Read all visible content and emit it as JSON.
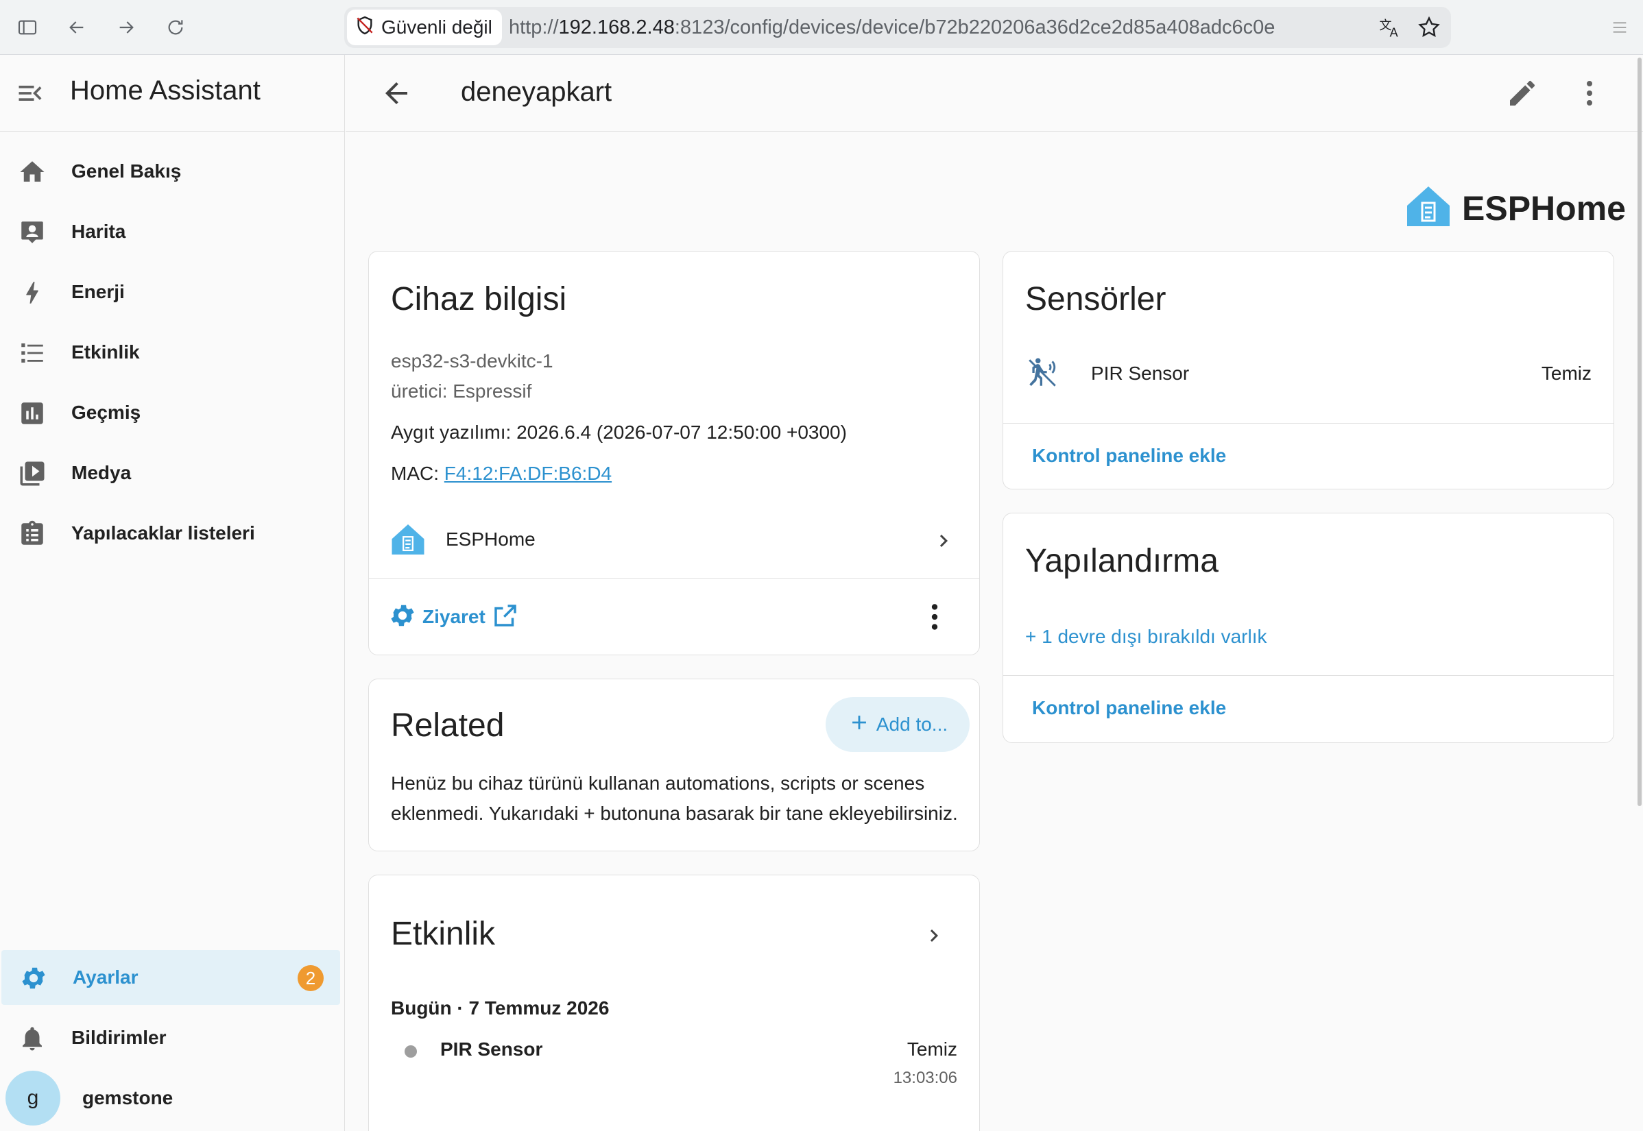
{
  "browser": {
    "security_label": "Güvenli değil",
    "url_scheme": "http://",
    "url_host": "192.168.2.48",
    "url_path": ":8123/config/devices/device/b72b220206a36d2ce2d85a408adc6c0e"
  },
  "sidebar": {
    "title": "Home Assistant",
    "items": [
      {
        "label": "Genel Bakış",
        "icon": "home-icon"
      },
      {
        "label": "Harita",
        "icon": "map-account-icon"
      },
      {
        "label": "Enerji",
        "icon": "lightning-bolt-icon"
      },
      {
        "label": "Etkinlik",
        "icon": "format-list-icon"
      },
      {
        "label": "Geçmiş",
        "icon": "chart-box-icon"
      },
      {
        "label": "Medya",
        "icon": "play-box-multiple-icon"
      },
      {
        "label": "Yapılacaklar listeleri",
        "icon": "clipboard-list-icon"
      }
    ],
    "settings_label": "Ayarlar",
    "settings_badge": "2",
    "notifications_label": "Bildirimler",
    "user_initial": "g",
    "user_name": "gemstone",
    "accent_color": "#2c91cf",
    "badge_color": "#ef9a30"
  },
  "header": {
    "title": "deneyapkart"
  },
  "brand": {
    "name": "ESPHome",
    "color": "#4fb3e8"
  },
  "device_info": {
    "title": "Cihaz bilgisi",
    "model": "esp32-s3-devkitc-1",
    "manufacturer": "üretici: Espressif",
    "firmware": "Aygıt yazılımı: 2026.6.4 (2026-07-07 12:50:00 +0300)",
    "mac_label": "MAC: ",
    "mac_value": "F4:12:FA:DF:B6:D4",
    "integration": "ESPHome",
    "visit_label": "Ziyaret"
  },
  "related": {
    "title": "Related",
    "add_label": "Add to...",
    "text_line1": "Henüz bu cihaz türünü kullanan automations, scripts or scenes",
    "text_line2": "eklenmedi. Yukarıdaki + butonuna basarak bir tane ekleyebilirsiniz."
  },
  "activity": {
    "title": "Etkinlik",
    "date": "Bugün · 7 Temmuz 2026",
    "entries": [
      {
        "name": "PIR Sensor",
        "state": "Temiz",
        "time": "13:03:06"
      }
    ]
  },
  "sensors": {
    "title": "Sensörler",
    "items": [
      {
        "name": "PIR Sensor",
        "state": "Temiz",
        "icon": "motion-sensor-icon"
      }
    ],
    "add_dashboard": "Kontrol paneline ekle"
  },
  "config": {
    "title": "Yapılandırma",
    "disabled_entities": "+ 1 devre dışı bırakıldı varlık",
    "add_dashboard": "Kontrol paneline ekle"
  }
}
